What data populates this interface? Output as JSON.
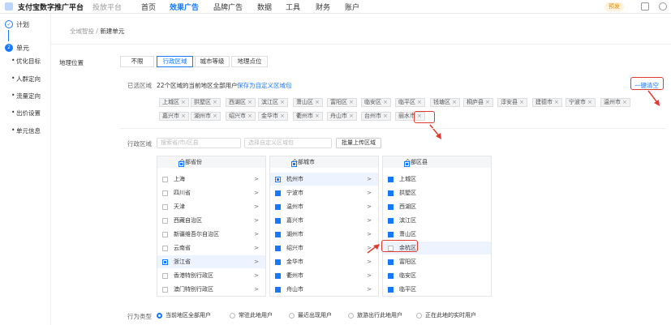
{
  "header": {
    "brand": "支付宝数字推广平台",
    "sub": "投放平台",
    "nav": [
      "首页",
      "效果广告",
      "品牌广告",
      "数据",
      "工具",
      "财务",
      "账户"
    ],
    "badge": "预发"
  },
  "sidebar": {
    "steps": [
      {
        "num": "✓",
        "label": "计划"
      },
      {
        "num": "2",
        "label": "单元"
      }
    ],
    "items": [
      "优化目标",
      "人群定向",
      "流量定向",
      "出价设置",
      "单元信息"
    ]
  },
  "breadcrumb": {
    "parent": "全域智投",
    "sep": "/",
    "current": "新建单元"
  },
  "location": {
    "label": "地理位置",
    "tabs": [
      "不限",
      "行政区域",
      "城市等级",
      "地理点位"
    ]
  },
  "selected": {
    "label": "已选区域",
    "summary": "22个区域的当前地区全部用户",
    "save_link": "保存为自定义区域包",
    "clear": "一键清空",
    "chips": [
      "上城区",
      "拱墅区",
      "西湖区",
      "滨江区",
      "萧山区",
      "富阳区",
      "临安区",
      "临平区",
      "钱塘区",
      "桐庐县",
      "淳安县",
      "建德市",
      "宁波市",
      "温州市",
      "嘉兴市",
      "湖州市",
      "绍兴市",
      "金华市",
      "衢州市",
      "舟山市",
      "台州市",
      "丽水市"
    ]
  },
  "region": {
    "label": "行政区域",
    "search_placeholder": "搜索省/市/区县",
    "custom_placeholder": "选择自定义区域包",
    "upload": "批量上传区域"
  },
  "prov": {
    "header": "全部省份",
    "rows": [
      "上海",
      "四川省",
      "天津",
      "西藏自治区",
      "新疆维吾尔自治区",
      "云南省",
      "浙江省",
      "香港特别行政区",
      "澳门特别行政区"
    ]
  },
  "city": {
    "header": "全部城市",
    "rows": [
      "杭州市",
      "宁波市",
      "温州市",
      "嘉兴市",
      "湖州市",
      "绍兴市",
      "金华市",
      "衢州市",
      "舟山市"
    ]
  },
  "dist": {
    "header": "全部区县",
    "rows": [
      "上城区",
      "拱墅区",
      "西湖区",
      "滨江区",
      "萧山区",
      "余杭区",
      "富阳区",
      "临安区",
      "临平区"
    ]
  },
  "behavior": {
    "label": "行为类型",
    "options": [
      "当前地区全部用户",
      "常驻此地用户",
      "最近出现用户",
      "旅游出行此地用户",
      "正在此地的实时用户"
    ]
  }
}
